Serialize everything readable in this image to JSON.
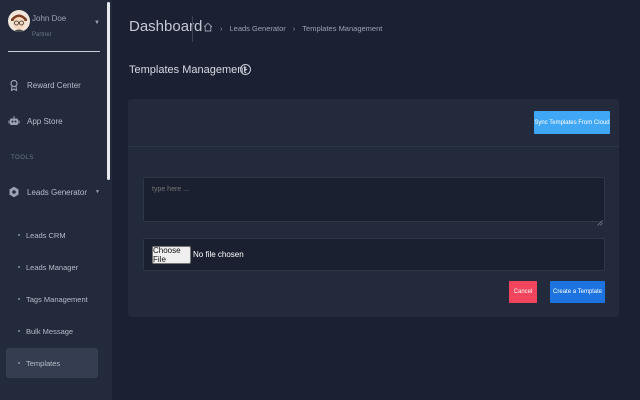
{
  "user": {
    "name": "John Doe",
    "role": "Partner"
  },
  "sidebar": {
    "items": [
      {
        "label": "Reward Center",
        "icon": "award-icon"
      },
      {
        "label": "App Store",
        "icon": "robot-icon"
      }
    ],
    "section_title": "TOOLS",
    "group": {
      "label": "Leads Generator",
      "icon": "gear-icon"
    },
    "sub_items": [
      {
        "label": "Leads CRM"
      },
      {
        "label": "Leads Manager"
      },
      {
        "label": "Tags Management"
      },
      {
        "label": "Bulk Message"
      },
      {
        "label": "Templates"
      }
    ]
  },
  "header": {
    "title": "Dashboard",
    "breadcrumb": [
      "Leads Generator",
      "Templates Management"
    ]
  },
  "page": {
    "heading": "Templates Management"
  },
  "card": {
    "sync_label": "Sync Templates From Cloud",
    "textarea_placeholder": "type here ...",
    "choose_file_label": "Choose File",
    "no_file_text": "No file chosen",
    "cancel_label": "Cancel",
    "create_label": "Create a Template"
  },
  "colors": {
    "background": "#1b2133",
    "sidebar": "#222a3c",
    "sync_button": "#3fa7f5",
    "cancel_button": "#f0455c",
    "create_button": "#1d74e0"
  }
}
